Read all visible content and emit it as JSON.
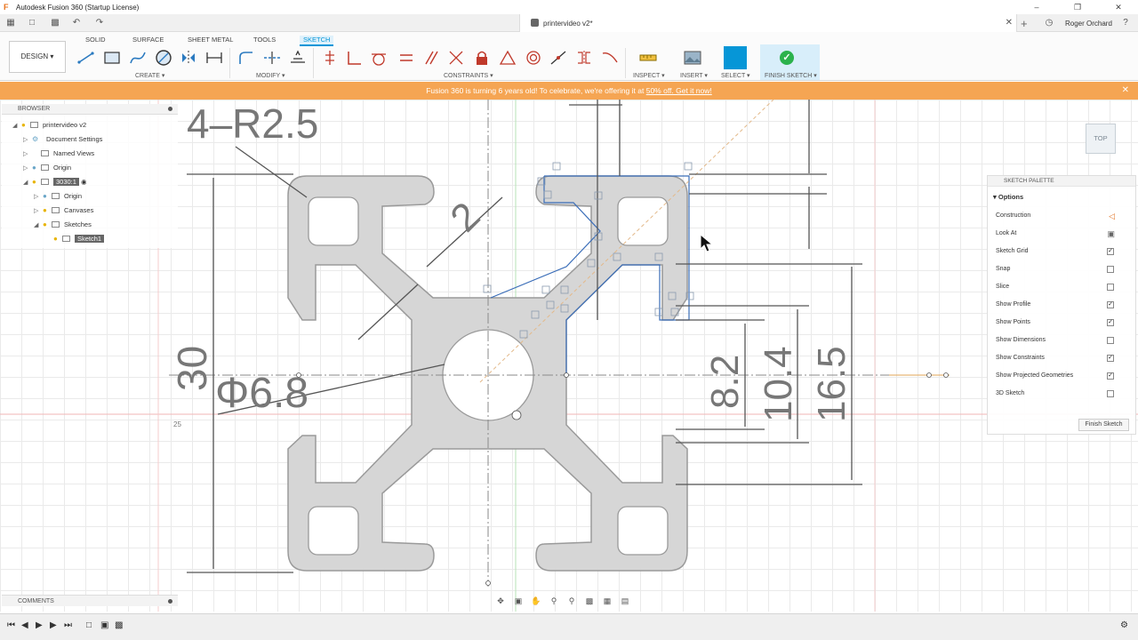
{
  "titlebar": {
    "title": "Autodesk Fusion 360 (Startup License)",
    "minimize_icon": "minimize-icon",
    "maximize_icon": "maximize-icon",
    "close_icon": "close-icon"
  },
  "tabstrip": {
    "document_tab": "printervideo v2*",
    "user": "Roger Orchard"
  },
  "ribbon": {
    "workspace": "DESIGN",
    "tabs": [
      "SOLID",
      "SURFACE",
      "SHEET METAL",
      "TOOLS",
      "SKETCH"
    ],
    "active_tab": "SKETCH",
    "groups": {
      "create": "CREATE",
      "modify": "MODIFY",
      "constraints": "CONSTRAINTS",
      "inspect": "INSPECT",
      "insert": "INSERT",
      "select": "SELECT",
      "finish": "FINISH SKETCH"
    }
  },
  "banner": {
    "text": "Fusion 360 is turning 6 years old! To celebrate, we're offering it at ",
    "link": "50% off. Get it now!",
    "color": "#f5a553"
  },
  "browser": {
    "title": "BROWSER",
    "root": "printervideo v2",
    "items": [
      {
        "label": "Document Settings"
      },
      {
        "label": "Named Views"
      },
      {
        "label": "Origin"
      },
      {
        "label": "3030:1"
      },
      {
        "label": "Origin"
      },
      {
        "label": "Canvases"
      },
      {
        "label": "Sketches"
      },
      {
        "label": "Sketch1"
      }
    ]
  },
  "palette": {
    "title": "SKETCH PALETTE",
    "section": "Options",
    "rows": [
      {
        "label": "Construction",
        "control": "construction-icon"
      },
      {
        "label": "Look At",
        "control": "look-at-icon"
      },
      {
        "label": "Sketch Grid",
        "checked": true
      },
      {
        "label": "Snap",
        "checked": false
      },
      {
        "label": "Slice",
        "checked": false
      },
      {
        "label": "Show Profile",
        "checked": true
      },
      {
        "label": "Show Points",
        "checked": true
      },
      {
        "label": "Show Dimensions",
        "checked": false
      },
      {
        "label": "Show Constraints",
        "checked": true
      },
      {
        "label": "Show Projected Geometries",
        "checked": true
      },
      {
        "label": "3D Sketch",
        "checked": false
      }
    ],
    "finish_button": "Finish Sketch"
  },
  "viewcube": {
    "face": "TOP"
  },
  "canvas_text": {
    "radius": "4–R2.5",
    "diameter": "Φ6.8",
    "thirty": "30",
    "two": "2",
    "d82": "8.2",
    "d104": "10.4",
    "d165": "16.5",
    "ruler": "25"
  },
  "comments": {
    "title": "COMMENTS"
  },
  "accent": "#0696d7"
}
